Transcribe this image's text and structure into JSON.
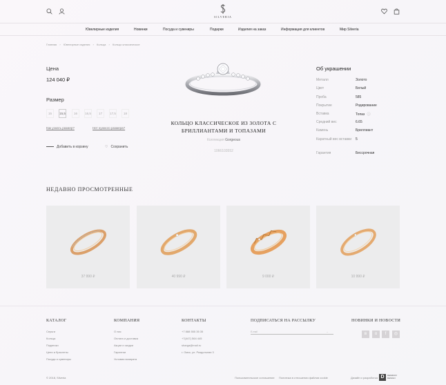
{
  "header": {
    "logo_text": "SILVERIA",
    "icons": [
      "search-icon",
      "user-icon",
      "heart-icon",
      "bag-icon"
    ]
  },
  "nav": {
    "items": [
      "Ювелирные изделия",
      "Новинки",
      "Посуда и сувениры",
      "Подарки",
      "Изделия на заказ",
      "Информация для клиентов",
      "Мир Silveria"
    ]
  },
  "breadcrumb": [
    "Главная",
    "Ювелирные изделия",
    "Кольца",
    "Кольцо классическое"
  ],
  "product": {
    "price_label": "Цена",
    "price": "124 040 ₽",
    "size_label": "Размер",
    "sizes": [
      "15",
      "15,5",
      "16",
      "16,5",
      "17",
      "17,5",
      "18"
    ],
    "selected_size_index": 1,
    "link_how_size": "Как узнать размер?",
    "link_no_size": "Нет нужного размера?",
    "add_to_cart": "Добавить в корзину",
    "save": "Сохранить",
    "title": "Кольцо классическое из золота с бриллиантами и топазами",
    "collection_prefix": "Коллекция",
    "collection": "Gorgeous",
    "sku": "1066103552"
  },
  "about": {
    "title": "Об украшении",
    "specs": [
      {
        "k": "Металл",
        "v": "Золото"
      },
      {
        "k": "Цвет",
        "v": "Белый"
      },
      {
        "k": "Проба",
        "v": "585"
      },
      {
        "k": "Покрытие",
        "v": "Родирование"
      },
      {
        "k": "Вставка",
        "v": "Топаз"
      },
      {
        "k": "Средний вес",
        "v": "6.65"
      },
      {
        "k": "Камень",
        "v": "Бриллиант"
      },
      {
        "k": "Каратный вес вставки",
        "v": "5"
      },
      {
        "k": "Гарантия",
        "v": "Бессрочная"
      }
    ]
  },
  "recent": {
    "title": "Недавно просмотренные",
    "items": [
      {
        "price": "37 990 ₽"
      },
      {
        "price": "40 990 ₽"
      },
      {
        "price": "9 000 ₽"
      },
      {
        "price": "10 990 ₽"
      }
    ]
  },
  "footer": {
    "catalog_title": "Каталог",
    "catalog_items": [
      "Серьги",
      "Кольца",
      "Подвески",
      "Цепи и браслеты",
      "Посуда и сувениры"
    ],
    "company_title": "Компания",
    "company_items": [
      "О нас",
      "Оплата и доставка",
      "Акции и скидки",
      "Гарантии",
      "Условия возврата"
    ],
    "contacts_title": "Контакты",
    "contacts_items": [
      "+7 888 555 35 35",
      "+7(447) 564 445",
      "sharga@mail.ru",
      "г. Омск, ул. Раздольная 3"
    ],
    "subscribe_title": "Подписаться на рассылку",
    "email_placeholder": "E-mail",
    "email_submit": "→",
    "news_title": "Новинки и новости",
    "copyright": "© 2018, Silveria",
    "policy": "Пользовательское соглашение",
    "privacy": "Политика в отношении файлов cookie",
    "dev_label": "Дизайн и разработка",
    "dev_logo": "D",
    "dev_name": "DEMIDOV DESIGN"
  },
  "colors": {
    "accent_gold": "#e7a566",
    "card_bg": "#ececed"
  }
}
